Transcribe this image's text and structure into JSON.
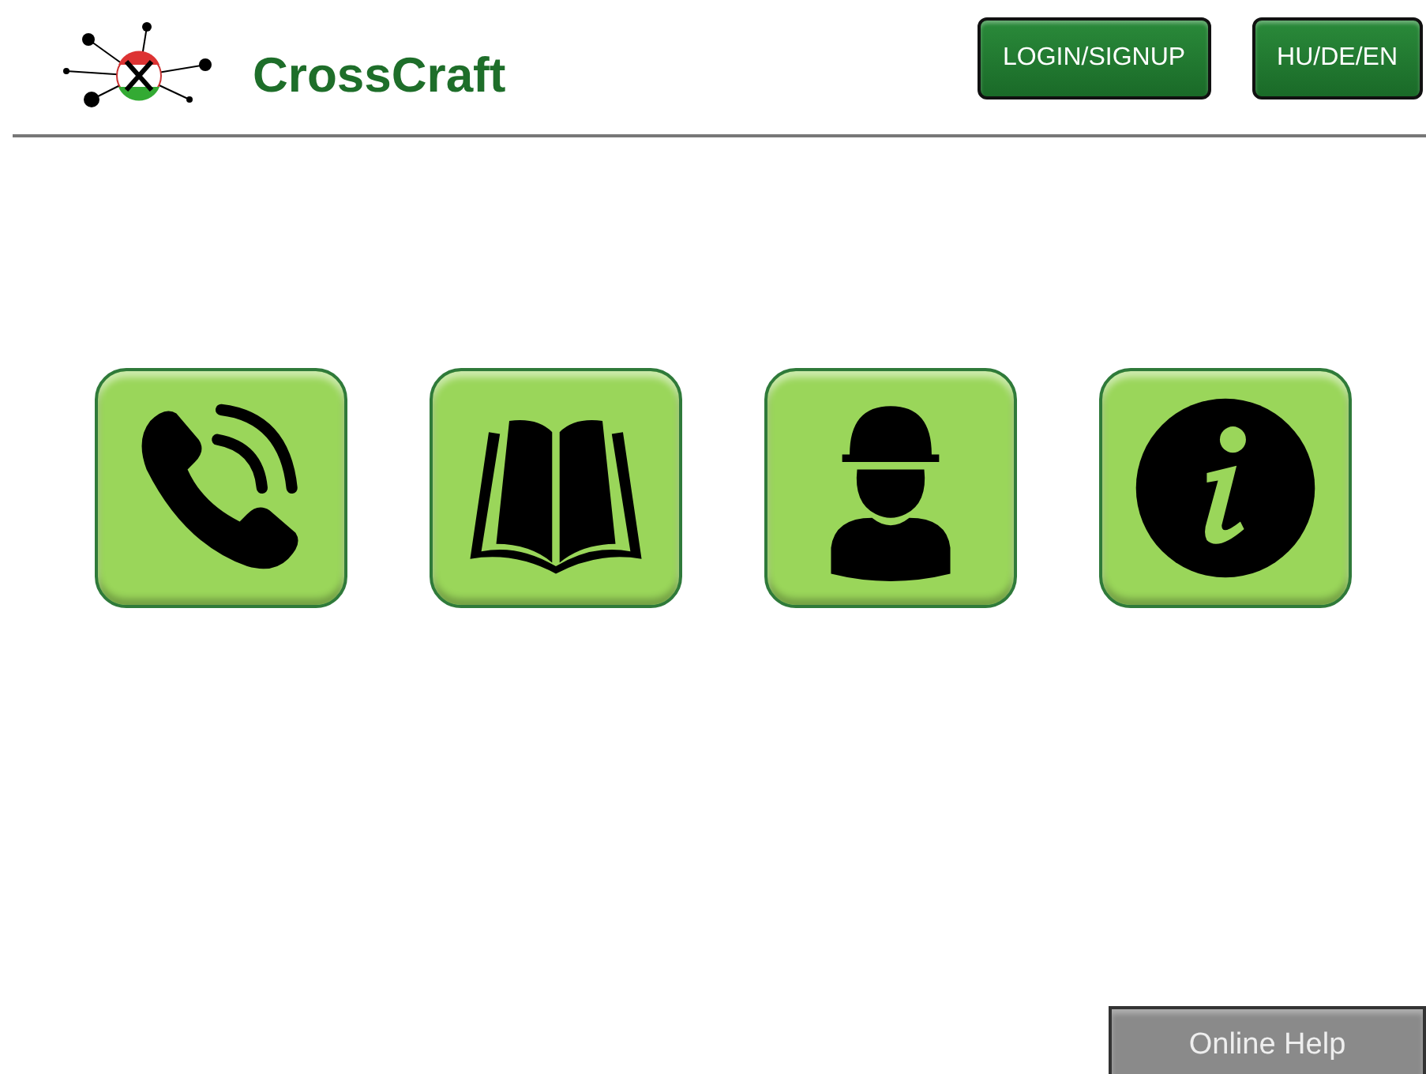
{
  "header": {
    "title": "CrossCraft",
    "buttons": [
      "LOGIN/SIGNUP",
      "HU/DE/EN"
    ]
  },
  "tiles": [
    {
      "kind": "phone"
    },
    {
      "kind": "book"
    },
    {
      "kind": "worker"
    },
    {
      "kind": "info"
    }
  ],
  "help_button": "Online Help"
}
